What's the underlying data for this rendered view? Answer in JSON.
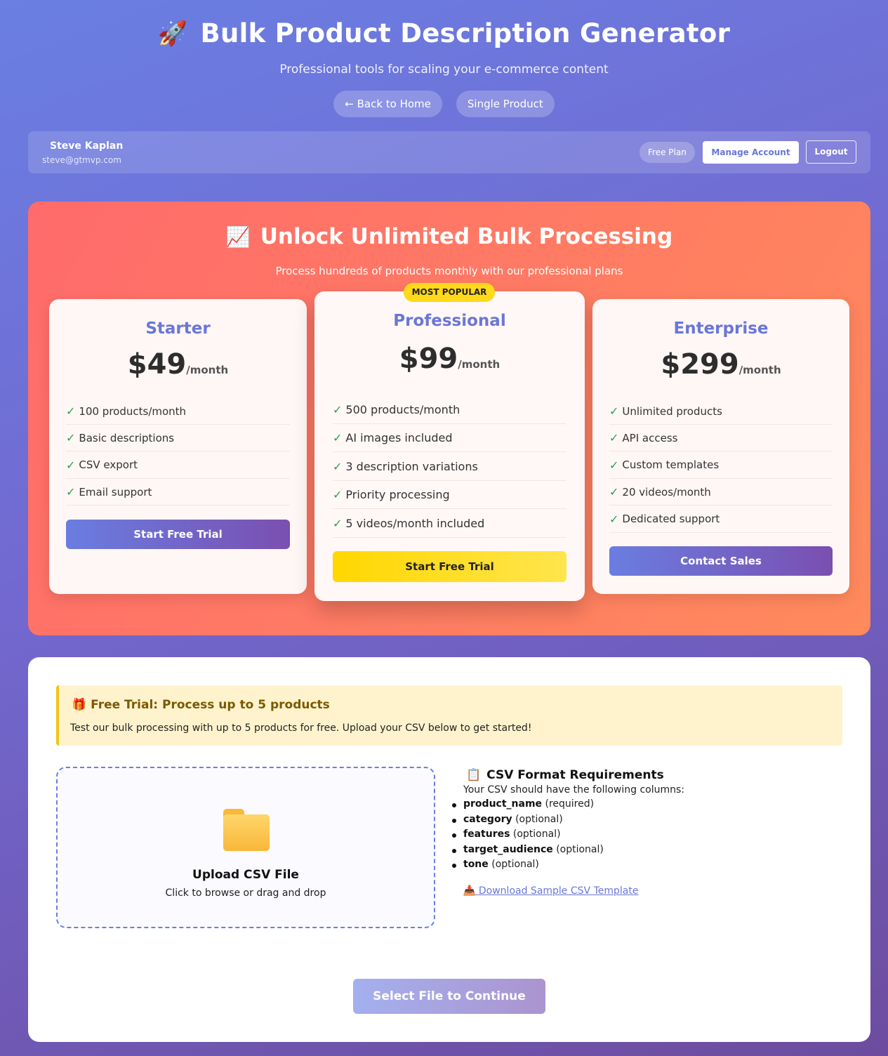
{
  "header": {
    "rocket_icon": "🚀",
    "title": "Bulk Product Description Generator",
    "subtitle": "Professional tools for scaling your e-commerce content",
    "nav": [
      "← Back to Home",
      "Single Product"
    ]
  },
  "user": {
    "name": "Steve Kaplan",
    "email": "steve@gtmvp.com",
    "plan": "Free Plan",
    "manage_label": "Manage Account",
    "logout_label": "Logout"
  },
  "upgrade": {
    "icon": "📈",
    "title": "Unlock Unlimited Bulk Processing",
    "subtitle": "Process hundreds of products monthly with our professional plans",
    "popular_badge": "MOST POPULAR",
    "check_symbol": "✓",
    "plans": [
      {
        "name": "Starter",
        "price": "$49",
        "period": "/month",
        "features": [
          "100 products/month",
          "Basic descriptions",
          "CSV export",
          "Email support"
        ],
        "button": "Start Free Trial"
      },
      {
        "name": "Professional",
        "price": "$99",
        "period": "/month",
        "features": [
          "500 products/month",
          "AI images included",
          "3 description variations",
          "Priority processing",
          "5 videos/month included"
        ],
        "button": "Start Free Trial"
      },
      {
        "name": "Enterprise",
        "price": "$299",
        "period": "/month",
        "features": [
          "Unlimited products",
          "API access",
          "Custom templates",
          "20 videos/month",
          "Dedicated support"
        ],
        "button": "Contact Sales"
      }
    ]
  },
  "trial": {
    "icon": "🎁",
    "title": "Free Trial: Process up to 5 products",
    "text": "Test our bulk processing with up to 5 products for free. Upload your CSV below to get started!"
  },
  "upload": {
    "title": "Upload CSV File",
    "subtitle": "Click to browse or drag and drop"
  },
  "requirements": {
    "icon": "📋",
    "title": "CSV Format Requirements",
    "intro": "Your CSV should have the following columns:",
    "columns": [
      {
        "name": "product_name",
        "note": "(required)"
      },
      {
        "name": "category",
        "note": "(optional)"
      },
      {
        "name": "features",
        "note": "(optional)"
      },
      {
        "name": "target_audience",
        "note": "(optional)"
      },
      {
        "name": "tone",
        "note": "(optional)"
      }
    ],
    "download_icon": "📥",
    "download_label": "Download Sample CSV Template"
  },
  "continue_label": "Select File to Continue",
  "colors": {
    "accent": "#6a76d8",
    "upgrade_bg": "#ff7a62",
    "gold": "#ffd700",
    "check": "#2e9e4f"
  }
}
